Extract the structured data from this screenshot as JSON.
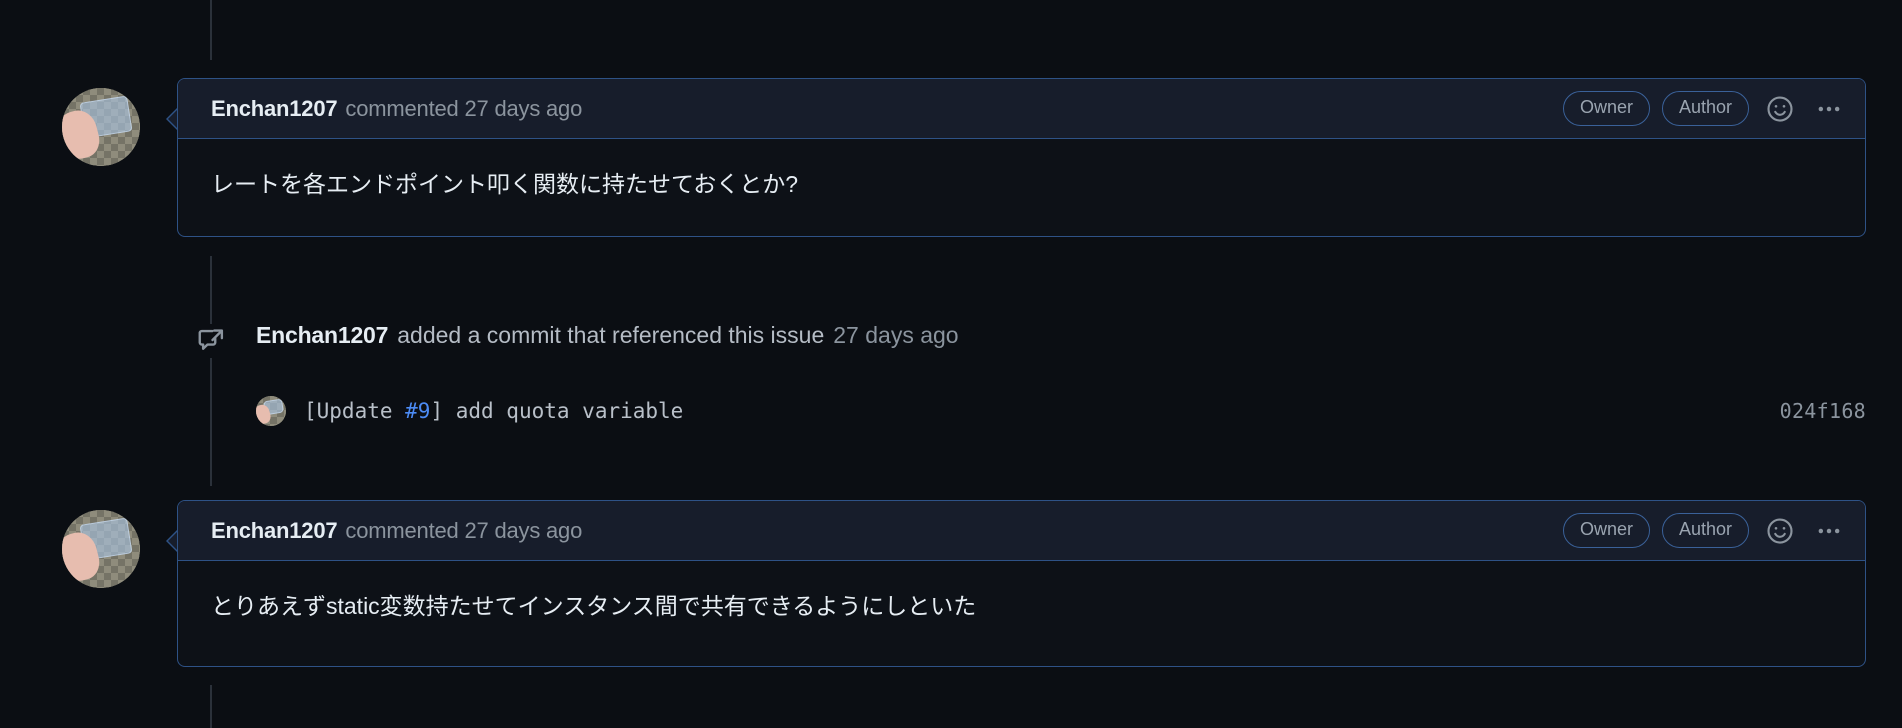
{
  "theme": {
    "page_bg": "#0b0e13",
    "comment_body_bg": "#0d1117",
    "comment_header_bg": "#171d2b",
    "comment_border": "#2e5286",
    "rail_color": "#2b313a",
    "link_blue": "#4c8bf5",
    "text_primary": "#e6edf3",
    "text_muted": "#8b949e",
    "badge_border": "#3a6199"
  },
  "comments": [
    {
      "author": "Enchan1207",
      "action": "commented 27 days ago",
      "badges": [
        "Owner",
        "Author"
      ],
      "reaction_icon": "smiley-icon",
      "menu_icon": "kebab-menu-icon",
      "body": "レートを各エンドポイント叩く関数に持たせておくとか?"
    },
    {
      "author": "Enchan1207",
      "action": "commented 27 days ago",
      "badges": [
        "Owner",
        "Author"
      ],
      "reaction_icon": "smiley-icon",
      "menu_icon": "kebab-menu-icon",
      "body": "とりあえずstatic変数持たせてインスタンス間で共有できるようにしといた"
    }
  ],
  "cross_reference_event": {
    "icon": "cross-reference-icon",
    "actor": "Enchan1207",
    "action": "added a commit that referenced this issue",
    "timestamp": "27 days ago",
    "commit": {
      "message_prefix": "[Update ",
      "issue_link": "#9",
      "message_suffix": "] add quota variable",
      "sha": "024f168"
    }
  }
}
